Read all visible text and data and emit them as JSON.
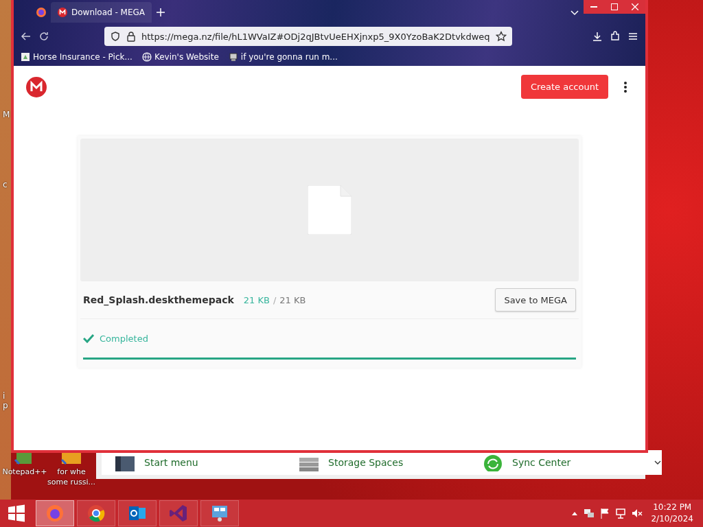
{
  "browser": {
    "tabs": [
      {
        "title": "Download - MEGA",
        "selected": true
      }
    ],
    "url": "https://mega.nz/file/hL1WVaIZ#ODj2qJBtvUeEHXjnxp5_9X0YzoBaK2Dtvkdweq",
    "bookmarks": [
      "Horse Insurance - Pick...",
      "Kevin's Website",
      "if you're gonna run m..."
    ]
  },
  "page": {
    "create_account": "Create account",
    "file": {
      "name": "Red_Splash.deskthemepack",
      "downloaded": "21 KB",
      "separator": "/",
      "size": "21 KB",
      "save_button": "Save to MEGA",
      "status": "Completed",
      "level": 1
    }
  },
  "background_window": {
    "items": [
      "Start menu",
      "Storage Spaces",
      "Sync Center"
    ]
  },
  "desktop": {
    "edge_labels": [
      "M",
      "c",
      "i",
      "p"
    ],
    "icons": [
      {
        "lines": [
          "Notepad++"
        ]
      },
      {
        "lines": [
          "for whe",
          "some russi..."
        ]
      }
    ]
  },
  "taskbar": {
    "apps": [
      {
        "kind": "firefox",
        "selected": true
      },
      {
        "kind": "chrome",
        "selected": false
      },
      {
        "kind": "outlook",
        "selected": false
      },
      {
        "kind": "visual-studio",
        "selected": false
      },
      {
        "kind": "control-panel",
        "selected": false
      }
    ],
    "time": "10:22 PM",
    "date": "2/10/2024"
  }
}
